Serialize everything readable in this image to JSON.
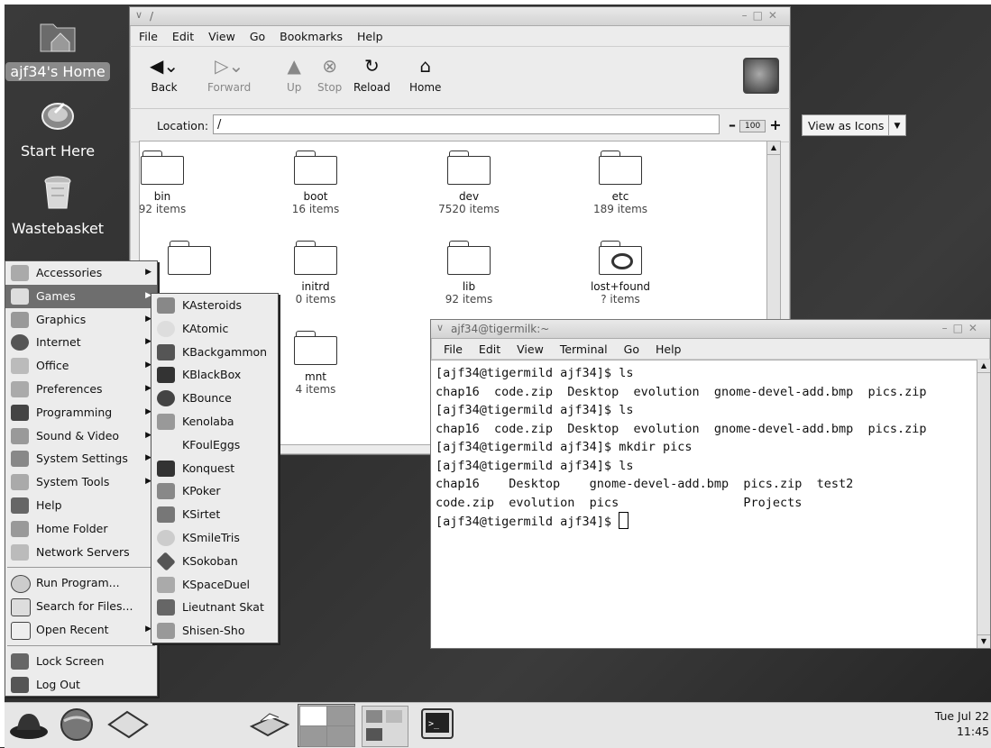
{
  "desktop_icons": [
    {
      "label": "ajf34's Home",
      "icon": "home-folder-icon",
      "selected": true
    },
    {
      "label": "Start Here",
      "icon": "start-here-icon",
      "selected": false
    },
    {
      "label": "Wastebasket",
      "icon": "trash-icon",
      "selected": false
    }
  ],
  "file_manager": {
    "title": "/",
    "menu": [
      "File",
      "Edit",
      "View",
      "Go",
      "Bookmarks",
      "Help"
    ],
    "toolbar": [
      {
        "label": "Back",
        "icon": "back-arrow-icon",
        "enabled": true
      },
      {
        "label": "Forward",
        "icon": "forward-arrow-icon",
        "enabled": false
      },
      {
        "label": "Up",
        "icon": "up-arrow-icon",
        "enabled": false
      },
      {
        "label": "Stop",
        "icon": "stop-icon",
        "enabled": false
      },
      {
        "label": "Reload",
        "icon": "reload-icon",
        "enabled": true
      },
      {
        "label": "Home",
        "icon": "home-icon",
        "enabled": true
      }
    ],
    "location_label": "Location:",
    "location_value": "/",
    "zoom_level": "100",
    "view_as": "View as Icons",
    "folders": [
      {
        "name": "bin",
        "count": "92 items"
      },
      {
        "name": "boot",
        "count": "16 items"
      },
      {
        "name": "dev",
        "count": "7520 items"
      },
      {
        "name": "etc",
        "count": "189 items"
      },
      {
        "name": "initrd",
        "count": "0 items"
      },
      {
        "name": "lib",
        "count": "92 items"
      },
      {
        "name": "lost+found",
        "count": "? items"
      },
      {
        "name": "mnt",
        "count": "4 items"
      }
    ]
  },
  "terminal": {
    "title": "ajf34@tigermilk:~",
    "menu": [
      "File",
      "Edit",
      "View",
      "Terminal",
      "Go",
      "Help"
    ],
    "lines": [
      "[ajf34@tigermild ajf34]$ ls",
      "chap16  code.zip  Desktop  evolution  gnome-devel-add.bmp  pics.zip",
      "[ajf34@tigermild ajf34]$ ls",
      "chap16  code.zip  Desktop  evolution  gnome-devel-add.bmp  pics.zip",
      "[ajf34@tigermild ajf34]$ mkdir pics",
      "[ajf34@tigermild ajf34]$ ls",
      "chap16    Desktop    gnome-devel-add.bmp  pics.zip  test2",
      "code.zip  evolution  pics                 Projects",
      "[ajf34@tigermild ajf34]$ "
    ]
  },
  "apps_menu": {
    "items": [
      {
        "label": "Accessories",
        "submenu": true
      },
      {
        "label": "Games",
        "submenu": true,
        "active": true
      },
      {
        "label": "Graphics",
        "submenu": true
      },
      {
        "label": "Internet",
        "submenu": true
      },
      {
        "label": "Office",
        "submenu": true
      },
      {
        "label": "Preferences",
        "submenu": true
      },
      {
        "label": "Programming",
        "submenu": true
      },
      {
        "label": "Sound & Video",
        "submenu": true
      },
      {
        "label": "System Settings",
        "submenu": true
      },
      {
        "label": "System Tools",
        "submenu": true
      },
      {
        "label": "Help",
        "submenu": false
      },
      {
        "label": "Home Folder",
        "submenu": false
      },
      {
        "label": "Network Servers",
        "submenu": false
      }
    ],
    "items2": [
      {
        "label": "Run Program...",
        "submenu": false
      },
      {
        "label": "Search for Files...",
        "submenu": false
      },
      {
        "label": "Open Recent",
        "submenu": true
      }
    ],
    "items3": [
      {
        "label": "Lock Screen",
        "submenu": false
      },
      {
        "label": "Log Out",
        "submenu": false
      }
    ]
  },
  "games_menu": [
    "KAsteroids",
    "KAtomic",
    "KBackgammon",
    "KBlackBox",
    "KBounce",
    "Kenolaba",
    "KFoulEggs",
    "Konquest",
    "KPoker",
    "KSirtet",
    "KSmileTris",
    "KSokoban",
    "KSpaceDuel",
    "Lieutnant Skat",
    "Shisen-Sho"
  ],
  "panel": {
    "clock_date": "Tue Jul 22",
    "clock_time": "11:45"
  }
}
